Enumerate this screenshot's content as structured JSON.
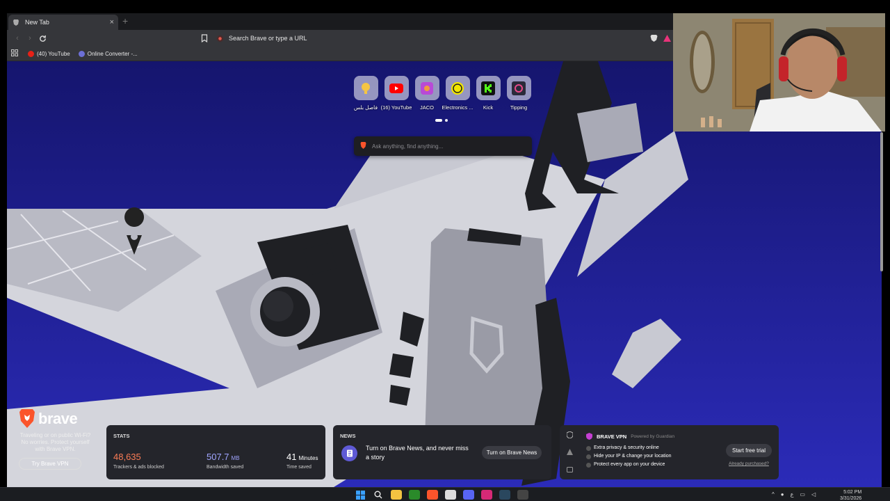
{
  "browser": {
    "tab_title": "New Tab",
    "tab_close": "×",
    "new_tab": "+",
    "omnibox_placeholder": "Search Brave or type a URL",
    "bookmarks": [
      {
        "label": "(40) YouTube",
        "color": "#e62117"
      },
      {
        "label": "Online Converter -...",
        "color": "#6c6fd6"
      }
    ]
  },
  "top_sites": [
    {
      "label": "فاصل بلس",
      "icon": "lightbulb-icon",
      "color": "#f5c542"
    },
    {
      "label": "(16) YouTube",
      "icon": "youtube-icon",
      "color": "#ff0000"
    },
    {
      "label": "JACO",
      "icon": "jaco-icon",
      "color": "#b84ad6"
    },
    {
      "label": "Electronics ...",
      "icon": "smiley-icon",
      "color": "#f2e600"
    },
    {
      "label": "Kick",
      "icon": "kick-icon",
      "color": "#53fc18"
    },
    {
      "label": "Tipping",
      "icon": "tipping-icon",
      "color": "#2a2a3a"
    }
  ],
  "search": {
    "placeholder": "Ask anything, find anything..."
  },
  "brand": {
    "name": "brave",
    "promo": "Traveling or on public Wi-Fi? No worries. Protect yourself with Brave VPN.",
    "button": "Try Brave VPN"
  },
  "stats": {
    "title": "STATS",
    "items": [
      {
        "value": "48,635",
        "unit": "",
        "desc": "Trackers & ads blocked",
        "color": "#fb7c56"
      },
      {
        "value": "507.7",
        "unit": "MB",
        "desc": "Bandwidth saved",
        "color": "#a0a5ff"
      },
      {
        "value": "41",
        "unit": "Minutes",
        "desc": "Time saved",
        "color": "#ffffff"
      }
    ]
  },
  "news": {
    "title": "NEWS",
    "story": "Turn on Brave News, and never miss a story",
    "button": "Turn on Brave News"
  },
  "vpn": {
    "title": "BRAVE VPN",
    "powered": "Powered by Guardian",
    "features": [
      "Extra privacy & security online",
      "Hide your IP & change your location",
      "Protect every app on your device"
    ],
    "button": "Start free trial",
    "purchased": "Already purchased?"
  },
  "taskbar": {
    "time": "5:02 PM",
    "date": "3/31/2026",
    "lang": "ع"
  },
  "colors": {
    "background": "#1c1d9a",
    "card": "#24252b",
    "toolbar": "#35363a"
  }
}
